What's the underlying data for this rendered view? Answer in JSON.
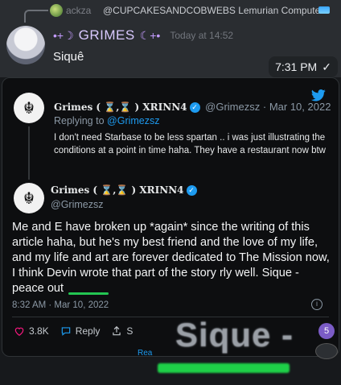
{
  "discord": {
    "reply_user": "ackza",
    "reply_text": "@CUPCAKESANDCOBWEBS Lemurian Computers",
    "author": "GRIMES",
    "author_deco_left": "•+☽",
    "author_deco_right": "☾+•",
    "timestamp": "Today at 14:52",
    "message": "Siquê",
    "bubble_time": "7:31 PM",
    "bubble_check": "✓"
  },
  "tweet": {
    "quoted": {
      "name": "Grimes ( ⌛,⌛ ) XRINN4",
      "handle": "@Grimezsz",
      "date": "· Mar 10, 2022",
      "replying_prefix": "Replying to",
      "replying_to": "@Grimezsz",
      "text": "I don't need Starbase to be less spartan .. i was just illustrating the conditions at a point in time haha. They have a restaurant now btw"
    },
    "main": {
      "name": "Grimes ( ⌛,⌛ ) XRINN4",
      "handle": "@Grimezsz",
      "text": "Me and E have broken up *again* since the writing of this article haha, but he's my best friend and the love of my life, and my life and art are forever dedicated to The Mission now, I think Devin wrote that part of the story rly well.  Sique - peace out",
      "datetime": "8:32 AM · Mar 10, 2022"
    },
    "actions": {
      "likes": "3.8K",
      "reply": "Reply",
      "share": "S"
    },
    "read_more": "Rea"
  },
  "overlay": {
    "zoom_word": "Sique -",
    "badge": "5"
  },
  "colors": {
    "twitter_blue": "#1d9bf0",
    "highlight_green": "#1ed048",
    "discord_bg": "#2a2d31"
  }
}
